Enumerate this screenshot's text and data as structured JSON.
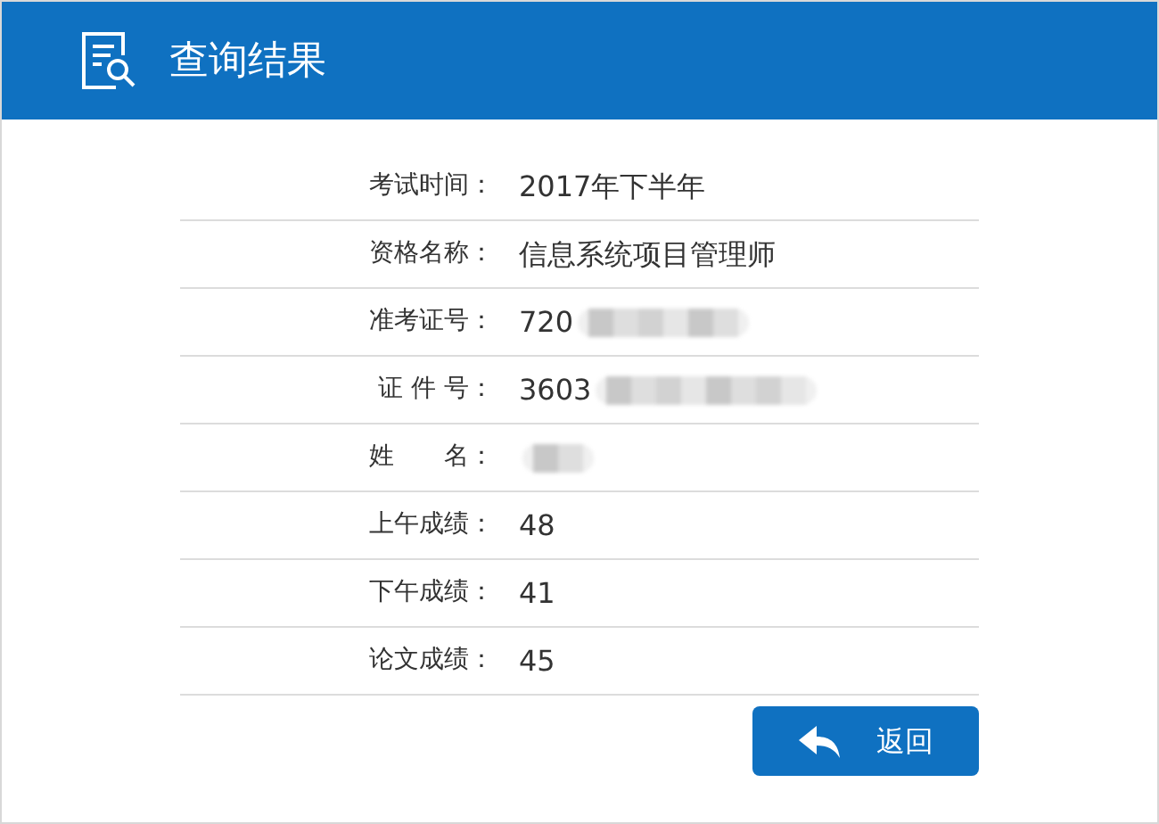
{
  "header": {
    "title": "查询结果"
  },
  "rows": [
    {
      "label": "考试时间：",
      "value": "2017年下半年",
      "kind": "plain"
    },
    {
      "label": "资格名称：",
      "value": "信息系统项目管理师",
      "kind": "plain"
    },
    {
      "label": "准考证号：",
      "value": "720",
      "kind": "redacted"
    },
    {
      "label": "证 件 号：",
      "value": "3603",
      "kind": "redacted"
    },
    {
      "label": "姓　　名：",
      "kind": "redacted"
    },
    {
      "label": "上午成绩：",
      "value": "48",
      "kind": "plain"
    },
    {
      "label": "下午成绩：",
      "value": "41",
      "kind": "plain"
    },
    {
      "label": "论文成绩：",
      "value": "45",
      "kind": "plain"
    }
  ],
  "back_button": {
    "label": "返回"
  }
}
